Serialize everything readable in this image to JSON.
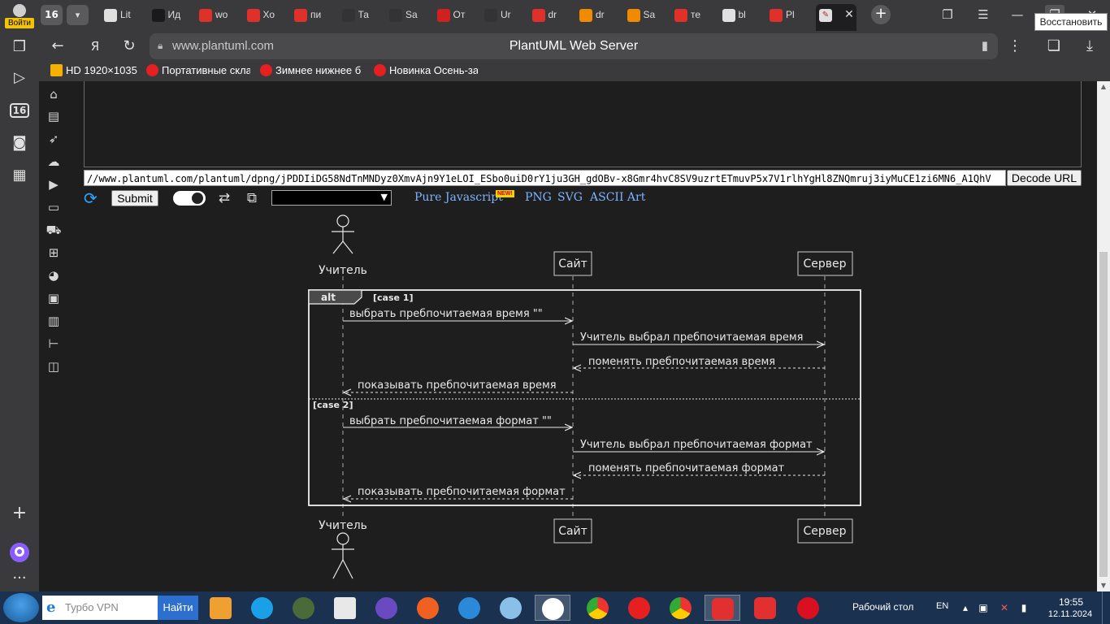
{
  "browser": {
    "profile_login": "Войти",
    "tab_count": "16",
    "tabs": [
      {
        "title": "Lit",
        "color": "#e0e0e0"
      },
      {
        "title": "Ид",
        "color": "#1a1a1a"
      },
      {
        "title": "wo",
        "color": "#e0302a"
      },
      {
        "title": "Хо",
        "color": "#e0302a"
      },
      {
        "title": "пи",
        "color": "#e0302a"
      },
      {
        "title": "Та",
        "color": "#333333"
      },
      {
        "title": "Sa",
        "color": "#333333"
      },
      {
        "title": "От",
        "color": "#d02020"
      },
      {
        "title": "Ur",
        "color": "#333333"
      },
      {
        "title": "dr",
        "color": "#e0302a"
      },
      {
        "title": "dr",
        "color": "#f08a00"
      },
      {
        "title": "Sa",
        "color": "#f08a00"
      },
      {
        "title": "те",
        "color": "#e0302a"
      },
      {
        "title": "bl",
        "color": "#e0e0e0"
      },
      {
        "title": "Pl",
        "color": "#e0302a"
      }
    ],
    "tooltip": "Восстановить",
    "url_domain": "www.plantuml.com",
    "page_title": "PlantUML Web Server",
    "bookmarks": [
      {
        "label": "HD 1920×1035"
      },
      {
        "label": "Портативные скла"
      },
      {
        "label": "Зимнее нижнее б"
      },
      {
        "label": "Новинка Осень-за"
      }
    ]
  },
  "plantuml": {
    "encoded_url": "//www.plantuml.com/plantuml/dpng/jPDDIiDG58NdTnMNDyz0XmvAjn9Y1eLOI_ESbo0uiD0rY1ju3GH_gdOBv-x8Gmr4hvC8SV9uzrtETmuvP5x7V1rlhYgHl8ZNQmruj3iyMuCE1zi6MN6_A1QhV",
    "decode_label": "Decode URL",
    "submit_label": "Submit",
    "links": {
      "pure_js": "Pure Javascript",
      "new_badge": "NEW!",
      "png": "PNG",
      "svg": "SVG",
      "ascii": "ASCII Art"
    }
  },
  "diagram": {
    "participants": {
      "teacher": "Учитель",
      "site": "Сайт",
      "server": "Сервер"
    },
    "alt_label": "alt",
    "case1": "[case 1]",
    "case2": "[case 2]",
    "messages1": [
      "выбрать пребпочитаемая время \"\"",
      "Учитель выбрал пребпочитаемая время",
      "поменять  пребпочитаемая время",
      "показывать  пребпочитаемая время"
    ],
    "messages2": [
      "выбрать пребпочитаемая формат \"\"",
      "Учитель выбрал пребпочитаемая формат",
      "поменять  пребпочитаемая формат",
      "показывать  пребпочитаемая формат"
    ]
  },
  "taskbar": {
    "search_placeholder": "Турбо VPN",
    "search_button": "Найти",
    "desktop_label": "Рабочий стол",
    "lang": "EN",
    "time": "19:55",
    "date": "12.11.2024"
  }
}
